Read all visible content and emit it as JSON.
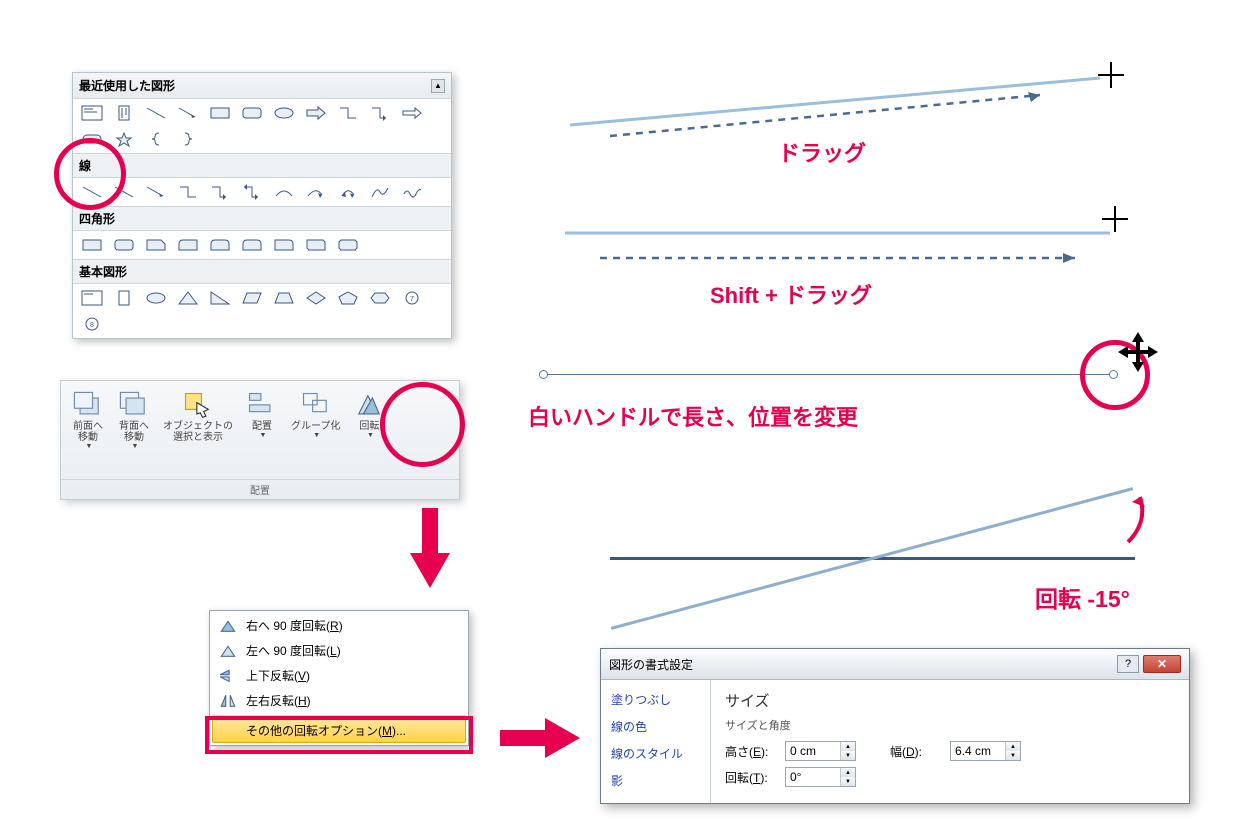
{
  "shapes_panel": {
    "recent_title": "最近使用した図形",
    "cat_line": "線",
    "cat_rect": "四角形",
    "cat_basic": "基本図形"
  },
  "ribbon": {
    "bring_forward": "前面へ\n移動",
    "send_backward": "背面へ\n移動",
    "selection_pane": "オブジェクトの\n選択と表示",
    "align": "配置",
    "group": "グループ化",
    "rotate": "回転",
    "group_label": "配置"
  },
  "rotate_menu": {
    "rotate_right": "右へ 90 度回転(",
    "rotate_right_key": "R",
    "rotate_left": "左へ 90 度回転(",
    "rotate_left_key": "L",
    "flip_v": "上下反転(",
    "flip_v_key": "V",
    "flip_h": "左右反転(",
    "flip_h_key": "H",
    "more": "その他の回転オプション(",
    "more_key": "M",
    "tail": ")",
    "tail_ellipsis": ")...",
    "tail_paren": ")"
  },
  "demo": {
    "drag": "ドラッグ",
    "shift_drag": "Shift + ドラッグ",
    "handle": "白いハンドルで長さ、位置を変更",
    "rotate_label": "回転 -15°"
  },
  "dialog": {
    "title": "図形の書式設定",
    "nav": {
      "fill": "塗りつぶし",
      "line_color": "線の色",
      "line_style": "線のスタイル",
      "shadow": "影"
    },
    "section": "サイズ",
    "subsection": "サイズと角度",
    "height_label": "高さ(",
    "height_key": "E",
    "width_label": "幅(",
    "width_key": "D",
    "rotation_label": "回転(",
    "rotation_key": "T",
    "height_value": "0 cm",
    "width_value": "6.4 cm",
    "rotation_value": "0°",
    "close_paren": "):"
  }
}
